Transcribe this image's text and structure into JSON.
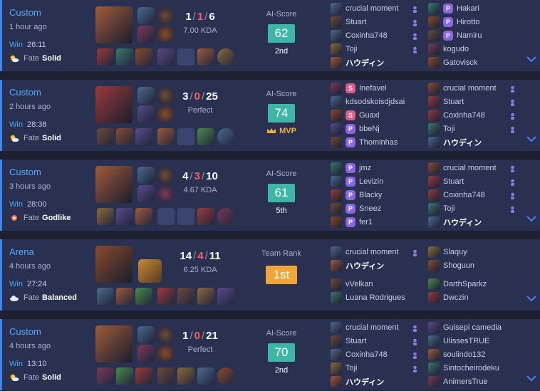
{
  "matches": [
    {
      "mode": "Custom",
      "time_ago": "1 hour ago",
      "result": "Win",
      "duration": "26:11",
      "fate_label": "Fate",
      "fate_value": "Solid",
      "fate_icon": "partly-sunny-icon",
      "kills": "1",
      "deaths": "1",
      "assists": "6",
      "kda_sub": "7.00 KDA",
      "score_label": "AI-Score",
      "score": "62",
      "score_style": "teal",
      "placement": "2nd",
      "placement_mvp": false,
      "champion_icon": "champion-vayne-icon",
      "spells": [
        "flash-icon",
        "ghost-icon"
      ],
      "runes": [
        "fleet-footwork-icon",
        "resolve-tree-icon"
      ],
      "items": [
        "item-1-icon",
        "item-2-icon",
        "item-3-icon",
        "item-4-icon",
        "empty-slot",
        "item-5-icon",
        "trinket-icon"
      ],
      "team_left": [
        {
          "name": "crucial moment",
          "badge": "",
          "me": false,
          "pin": true
        },
        {
          "name": "Stuart",
          "badge": "",
          "me": false,
          "pin": true
        },
        {
          "name": "Coxinha748",
          "badge": "",
          "me": false,
          "pin": true
        },
        {
          "name": "Toji",
          "badge": "",
          "me": false,
          "pin": true
        },
        {
          "name": "ハウディン",
          "badge": "",
          "me": true,
          "pin": false
        }
      ],
      "team_right": [
        {
          "name": "Hakari",
          "badge": "P",
          "me": false,
          "pin": false
        },
        {
          "name": "Hirotto",
          "badge": "P",
          "me": false,
          "pin": false
        },
        {
          "name": "Namiru",
          "badge": "P",
          "me": false,
          "pin": false
        },
        {
          "name": "kogudo",
          "badge": "",
          "me": false,
          "pin": false
        },
        {
          "name": "Gatovisck",
          "badge": "",
          "me": false,
          "pin": false
        }
      ]
    },
    {
      "mode": "Custom",
      "time_ago": "2 hours ago",
      "result": "Win",
      "duration": "28:38",
      "fate_label": "Fate",
      "fate_value": "Solid",
      "fate_icon": "partly-sunny-icon",
      "kills": "3",
      "deaths": "0",
      "assists": "25",
      "kda_sub": "Perfect",
      "score_label": "AI-Score",
      "score": "74",
      "score_style": "teal",
      "placement": "MVP",
      "placement_mvp": true,
      "champion_icon": "champion-samira-icon",
      "spells": [
        "flash-icon",
        "heal-icon"
      ],
      "runes": [
        "conqueror-icon",
        "resolve-tree-icon"
      ],
      "items": [
        "item-1-icon",
        "item-2-icon",
        "item-3-icon",
        "item-4-icon",
        "empty-slot",
        "item-5-icon",
        "trinket-icon"
      ],
      "team_left": [
        {
          "name": "Inefavel",
          "badge": "S",
          "me": false,
          "pin": false
        },
        {
          "name": "kdsodskoisdjdsai",
          "badge": "",
          "me": false,
          "pin": false
        },
        {
          "name": "Guaxi",
          "badge": "S",
          "me": false,
          "pin": false
        },
        {
          "name": "bbeNj",
          "badge": "P",
          "me": false,
          "pin": false
        },
        {
          "name": "Thominhas",
          "badge": "P",
          "me": false,
          "pin": false
        }
      ],
      "team_right": [
        {
          "name": "crucial moment",
          "badge": "",
          "me": false,
          "pin": true
        },
        {
          "name": "Stuart",
          "badge": "",
          "me": false,
          "pin": true
        },
        {
          "name": "Coxinha748",
          "badge": "",
          "me": false,
          "pin": true
        },
        {
          "name": "Toji",
          "badge": "",
          "me": false,
          "pin": true
        },
        {
          "name": "ハウディン",
          "badge": "",
          "me": true,
          "pin": false
        }
      ]
    },
    {
      "mode": "Custom",
      "time_ago": "3 hours ago",
      "result": "Win",
      "duration": "28:00",
      "fate_label": "Fate",
      "fate_value": "Godlike",
      "fate_icon": "sun-burst-icon",
      "kills": "4",
      "deaths": "3",
      "assists": "10",
      "kda_sub": "4.67 KDA",
      "score_label": "AI-Score",
      "score": "61",
      "score_style": "teal",
      "placement": "5th",
      "placement_mvp": false,
      "champion_icon": "champion-vex-icon",
      "spells": [
        "flash-icon",
        "heal-icon"
      ],
      "runes": [
        "fleet-footwork-icon",
        "domination-tree-icon"
      ],
      "items": [
        "item-1-icon",
        "item-2-icon",
        "item-3-icon",
        "empty-slot",
        "empty-slot",
        "item-5-icon",
        "trinket-icon"
      ],
      "team_left": [
        {
          "name": "jmz",
          "badge": "P",
          "me": false,
          "pin": false
        },
        {
          "name": "Levizin",
          "badge": "P",
          "me": false,
          "pin": false
        },
        {
          "name": "Blacky",
          "badge": "P",
          "me": false,
          "pin": false
        },
        {
          "name": "Sneez",
          "badge": "P",
          "me": false,
          "pin": false
        },
        {
          "name": "fer1",
          "badge": "P",
          "me": false,
          "pin": false
        }
      ],
      "team_right": [
        {
          "name": "crucial moment",
          "badge": "",
          "me": false,
          "pin": true
        },
        {
          "name": "Stuart",
          "badge": "",
          "me": false,
          "pin": true
        },
        {
          "name": "Coxinha748",
          "badge": "",
          "me": false,
          "pin": true
        },
        {
          "name": "Toji",
          "badge": "",
          "me": false,
          "pin": true
        },
        {
          "name": "ハウディン",
          "badge": "",
          "me": true,
          "pin": false
        }
      ]
    },
    {
      "mode": "Arena",
      "time_ago": "4 hours ago",
      "result": "Win",
      "duration": "27:24",
      "fate_label": "Fate",
      "fate_value": "Balanced",
      "fate_icon": "cloud-icon",
      "kills": "14",
      "deaths": "4",
      "assists": "11",
      "kda_sub": "6.25 KDA",
      "score_label": "Team Rank",
      "score": "1st",
      "score_style": "gold",
      "placement": "",
      "placement_mvp": false,
      "champion_icon": "champion-varus-icon",
      "spells": [
        "augment-icon"
      ],
      "runes": [],
      "items": [
        "item-1-icon",
        "item-2-icon",
        "item-3-icon",
        "item-4-icon",
        "item-5-icon",
        "item-6-icon",
        "item-7-icon"
      ],
      "team_left": [
        {
          "name": "crucial moment",
          "badge": "",
          "me": false,
          "pin": true
        },
        {
          "name": "ハウディン",
          "badge": "",
          "me": true,
          "pin": false
        },
        {
          "name": "vVelkan",
          "badge": "",
          "me": false,
          "pin": false
        },
        {
          "name": "Luana Rodrigues",
          "badge": "",
          "me": false,
          "pin": false
        }
      ],
      "team_right": [
        {
          "name": "Slaquy",
          "badge": "",
          "me": false,
          "pin": false
        },
        {
          "name": "Shoguun",
          "badge": "",
          "me": false,
          "pin": false
        },
        {
          "name": "DarthSparkz",
          "badge": "",
          "me": false,
          "pin": false
        },
        {
          "name": "Dwczin",
          "badge": "",
          "me": false,
          "pin": false
        }
      ]
    },
    {
      "mode": "Custom",
      "time_ago": "4 hours ago",
      "result": "Win",
      "duration": "13:10",
      "fate_label": "Fate",
      "fate_value": "Solid",
      "fate_icon": "partly-sunny-icon",
      "kills": "1",
      "deaths": "0",
      "assists": "21",
      "kda_sub": "Perfect",
      "score_label": "AI-Score",
      "score": "70",
      "score_style": "teal",
      "placement": "2nd",
      "placement_mvp": false,
      "champion_icon": "champion-vayne-icon",
      "spells": [
        "flash-icon",
        "ghost-icon"
      ],
      "runes": [
        "conqueror-icon",
        "resolve-tree-icon"
      ],
      "items": [
        "item-1-icon",
        "item-2-icon",
        "item-3-icon",
        "item-4-icon",
        "item-5-icon",
        "item-6-icon",
        "trinket-icon"
      ],
      "team_left": [
        {
          "name": "crucial moment",
          "badge": "",
          "me": false,
          "pin": true
        },
        {
          "name": "Stuart",
          "badge": "",
          "me": false,
          "pin": true
        },
        {
          "name": "Coxinha748",
          "badge": "",
          "me": false,
          "pin": true
        },
        {
          "name": "Toji",
          "badge": "",
          "me": false,
          "pin": true
        },
        {
          "name": "ハウディン",
          "badge": "",
          "me": true,
          "pin": false
        }
      ],
      "team_right": [
        {
          "name": "Guisepi camedia",
          "badge": "",
          "me": false,
          "pin": false
        },
        {
          "name": "UlissesTRUE",
          "badge": "",
          "me": false,
          "pin": false
        },
        {
          "name": "soulindo132",
          "badge": "",
          "me": false,
          "pin": false
        },
        {
          "name": "Sintocheirodeku",
          "badge": "",
          "me": false,
          "pin": false
        },
        {
          "name": "AnimersTrue",
          "badge": "",
          "me": false,
          "pin": false
        }
      ]
    }
  ],
  "colors": {
    "accent": "#3a86f5",
    "win": "#4fa8ff",
    "score_teal": "#3eb5a5",
    "score_gold": "#f0a53a",
    "death": "#ff5d5d",
    "mvp": "#f0b23b",
    "badge_p": "#8a67e0",
    "badge_s": "#e05a8a"
  }
}
